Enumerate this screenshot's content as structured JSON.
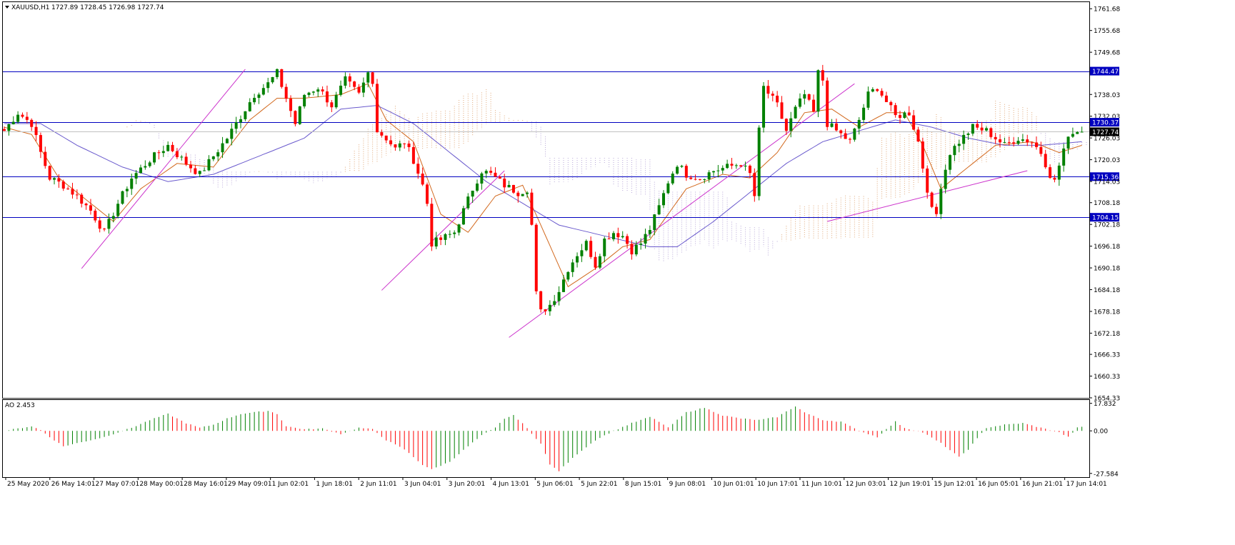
{
  "header": {
    "symbol": "XAUUSD,H1",
    "ohlc": "1727.89 1728.45 1726.98 1727.74"
  },
  "ao_header": {
    "label": "AO 2.453"
  },
  "colors": {
    "bull": "#008000",
    "bear": "#ff0000",
    "hline": "#0000c0",
    "trendline": "#cc33cc",
    "ma_fast": "#d2691e",
    "ma_slow": "#6a5acd",
    "cloud_bull": "#e0a878",
    "cloud_bear": "#b8a8d8",
    "current_line": "#c0c0c0"
  },
  "chart_data": [
    {
      "type": "candlestick",
      "title": "XAUUSD,H1",
      "y_axis_ticks": [
        "1761.68",
        "1755.68",
        "1749.68",
        "1744.47",
        "1738.03",
        "1732.03",
        "1730.37",
        "1727.74",
        "1726.03",
        "1720.03",
        "1715.36",
        "1714.03",
        "1708.18",
        "1704.15",
        "1702.18",
        "1696.18",
        "1690.18",
        "1684.18",
        "1678.18",
        "1672.18",
        "1666.33",
        "1660.33",
        "1654.33"
      ],
      "x_axis_ticks": [
        "25 May 2020",
        "26 May 14:01",
        "27 May 07:01",
        "28 May 00:01",
        "28 May 16:01",
        "29 May 09:01",
        "1 Jun 02:01",
        "1 Jun 18:01",
        "2 Jun 11:01",
        "3 Jun 04:01",
        "3 Jun 20:01",
        "4 Jun 13:01",
        "5 Jun 06:01",
        "5 Jun 22:01",
        "8 Jun 15:01",
        "9 Jun 08:01",
        "10 Jun 01:01",
        "10 Jun 17:01",
        "11 Jun 10:01",
        "12 Jun 03:01",
        "12 Jun 19:01",
        "15 Jun 12:01",
        "16 Jun 05:01",
        "16 Jun 21:01",
        "17 Jun 14:01"
      ],
      "ylim": [
        1654.33,
        1763.5
      ],
      "horizontal_levels": [
        {
          "label": "1744.47",
          "value": 1744.47
        },
        {
          "label": "1730.37",
          "value": 1730.37
        },
        {
          "label": "1715.36",
          "value": 1715.36
        },
        {
          "label": "1704.15",
          "value": 1704.15
        }
      ],
      "current_price": {
        "label": "1727.74",
        "value": 1727.74
      },
      "close_path": [
        [
          0,
          1728
        ],
        [
          3,
          1733
        ],
        [
          6,
          1730
        ],
        [
          8,
          1722
        ],
        [
          10,
          1715
        ],
        [
          13,
          1713
        ],
        [
          16,
          1710
        ],
        [
          19,
          1706
        ],
        [
          22,
          1700
        ],
        [
          25,
          1708
        ],
        [
          28,
          1715
        ],
        [
          32,
          1720
        ],
        [
          36,
          1724
        ],
        [
          40,
          1719
        ],
        [
          43,
          1716
        ],
        [
          46,
          1721
        ],
        [
          49,
          1726
        ],
        [
          52,
          1732
        ],
        [
          55,
          1738
        ],
        [
          58,
          1741
        ],
        [
          60,
          1744
        ],
        [
          62,
          1737
        ],
        [
          64,
          1730
        ],
        [
          66,
          1738
        ],
        [
          69,
          1740
        ],
        [
          72,
          1735
        ],
        [
          75,
          1742
        ],
        [
          78,
          1738
        ],
        [
          80,
          1744
        ],
        [
          81,
          1742
        ],
        [
          82,
          1728
        ],
        [
          84,
          1726
        ],
        [
          86,
          1723
        ],
        [
          88,
          1725
        ],
        [
          90,
          1720
        ],
        [
          92,
          1713
        ],
        [
          93,
          1708
        ],
        [
          94,
          1697
        ],
        [
          96,
          1698
        ],
        [
          99,
          1700
        ],
        [
          101,
          1706
        ],
        [
          103,
          1712
        ],
        [
          105,
          1717
        ],
        [
          107,
          1716
        ],
        [
          110,
          1713
        ],
        [
          113,
          1711
        ],
        [
          115,
          1712
        ],
        [
          116,
          1702
        ],
        [
          117,
          1683
        ],
        [
          118,
          1678
        ],
        [
          120,
          1680
        ],
        [
          122,
          1684
        ],
        [
          124,
          1690
        ],
        [
          126,
          1694
        ],
        [
          128,
          1697
        ],
        [
          130,
          1691
        ],
        [
          132,
          1698
        ],
        [
          134,
          1700
        ],
        [
          136,
          1699
        ],
        [
          138,
          1695
        ],
        [
          140,
          1697
        ],
        [
          142,
          1701
        ],
        [
          144,
          1707
        ],
        [
          146,
          1714
        ],
        [
          148,
          1719
        ],
        [
          150,
          1716
        ],
        [
          153,
          1715
        ],
        [
          156,
          1717
        ],
        [
          159,
          1718
        ],
        [
          162,
          1719
        ],
        [
          164,
          1716
        ],
        [
          165,
          1710
        ],
        [
          166,
          1728
        ],
        [
          167,
          1740
        ],
        [
          170,
          1735
        ],
        [
          172,
          1728
        ],
        [
          174,
          1734
        ],
        [
          176,
          1738
        ],
        [
          178,
          1733
        ],
        [
          179,
          1744
        ],
        [
          180,
          1742
        ],
        [
          181,
          1730
        ],
        [
          183,
          1728
        ],
        [
          186,
          1725
        ],
        [
          188,
          1731
        ],
        [
          190,
          1738
        ],
        [
          192,
          1740
        ],
        [
          194,
          1736
        ],
        [
          196,
          1732
        ],
        [
          199,
          1733
        ],
        [
          201,
          1725
        ],
        [
          202,
          1718
        ],
        [
          203,
          1712
        ],
        [
          204,
          1706
        ],
        [
          205,
          1705
        ],
        [
          206,
          1713
        ],
        [
          208,
          1722
        ],
        [
          210,
          1725
        ],
        [
          213,
          1729
        ],
        [
          216,
          1728
        ],
        [
          218,
          1726
        ],
        [
          220,
          1724
        ],
        [
          223,
          1726
        ],
        [
          226,
          1725
        ],
        [
          228,
          1722
        ],
        [
          230,
          1716
        ],
        [
          231,
          1714
        ],
        [
          233,
          1723
        ],
        [
          235,
          1728
        ],
        [
          237,
          1727.74
        ]
      ],
      "moving_averages": [
        {
          "name": "",
          "color": "#d2691e",
          "values": [
            [
              0,
              1729
            ],
            [
              6,
              1727
            ],
            [
              12,
              1715
            ],
            [
              18,
              1709
            ],
            [
              24,
              1703
            ],
            [
              30,
              1712
            ],
            [
              38,
              1719
            ],
            [
              46,
              1718
            ],
            [
              54,
              1731
            ],
            [
              60,
              1737
            ],
            [
              66,
              1737
            ],
            [
              74,
              1738
            ],
            [
              80,
              1741
            ],
            [
              84,
              1731
            ],
            [
              90,
              1725
            ],
            [
              96,
              1705
            ],
            [
              102,
              1700
            ],
            [
              108,
              1710
            ],
            [
              114,
              1713
            ],
            [
              118,
              1702
            ],
            [
              124,
              1685
            ],
            [
              130,
              1690
            ],
            [
              136,
              1696
            ],
            [
              142,
              1698
            ],
            [
              150,
              1712
            ],
            [
              158,
              1716
            ],
            [
              164,
              1715
            ],
            [
              170,
              1722
            ],
            [
              176,
              1733
            ],
            [
              182,
              1734
            ],
            [
              188,
              1729
            ],
            [
              194,
              1733
            ],
            [
              198,
              1733
            ],
            [
              202,
              1724
            ],
            [
              206,
              1712
            ],
            [
              212,
              1718
            ],
            [
              218,
              1724
            ],
            [
              226,
              1725
            ],
            [
              232,
              1722
            ],
            [
              237,
              1724
            ]
          ]
        },
        {
          "name": "",
          "color": "#6a5acd",
          "values": [
            [
              0,
              1730
            ],
            [
              8,
              1730
            ],
            [
              16,
              1724
            ],
            [
              26,
              1718
            ],
            [
              36,
              1714
            ],
            [
              46,
              1716
            ],
            [
              56,
              1721
            ],
            [
              66,
              1726
            ],
            [
              74,
              1734
            ],
            [
              82,
              1735
            ],
            [
              90,
              1730
            ],
            [
              98,
              1722
            ],
            [
              106,
              1714
            ],
            [
              114,
              1708
            ],
            [
              122,
              1702
            ],
            [
              132,
              1699
            ],
            [
              142,
              1696
            ],
            [
              148,
              1696
            ],
            [
              156,
              1703
            ],
            [
              164,
              1711
            ],
            [
              172,
              1719
            ],
            [
              180,
              1725
            ],
            [
              188,
              1728
            ],
            [
              196,
              1731
            ],
            [
              204,
              1729
            ],
            [
              212,
              1726
            ],
            [
              220,
              1724
            ],
            [
              228,
              1724
            ],
            [
              237,
              1725
            ]
          ]
        }
      ],
      "trendlines": [
        {
          "from": [
            17,
            1690
          ],
          "to": [
            53,
            1745
          ]
        },
        {
          "from": [
            83,
            1684
          ],
          "to": [
            110,
            1717
          ]
        },
        {
          "from": [
            111,
            1671
          ],
          "to": [
            187,
            1741
          ]
        },
        {
          "from": [
            181,
            1703
          ],
          "to": [
            225,
            1717
          ]
        }
      ]
    },
    {
      "type": "bar",
      "title": "AO 2.453",
      "y_axis_ticks": [
        "17.832",
        "0.00",
        "-27.584"
      ],
      "ylim": [
        -30,
        20
      ],
      "histogram_path": [
        [
          0,
          0
        ],
        [
          3,
          1.5
        ],
        [
          6,
          3
        ],
        [
          8,
          0.5
        ],
        [
          10,
          -4
        ],
        [
          13,
          -10
        ],
        [
          16,
          -8
        ],
        [
          19,
          -6
        ],
        [
          22,
          -4
        ],
        [
          25,
          -1
        ],
        [
          28,
          2
        ],
        [
          32,
          7
        ],
        [
          36,
          11
        ],
        [
          40,
          5
        ],
        [
          43,
          2
        ],
        [
          46,
          4
        ],
        [
          49,
          8
        ],
        [
          52,
          11
        ],
        [
          55,
          12
        ],
        [
          58,
          13
        ],
        [
          60,
          11
        ],
        [
          62,
          3
        ],
        [
          66,
          1
        ],
        [
          70,
          1.5
        ],
        [
          74,
          -2
        ],
        [
          78,
          2
        ],
        [
          81,
          1
        ],
        [
          84,
          -6
        ],
        [
          88,
          -12
        ],
        [
          92,
          -22
        ],
        [
          94,
          -25
        ],
        [
          98,
          -20
        ],
        [
          102,
          -10
        ],
        [
          105,
          -3
        ],
        [
          108,
          2
        ],
        [
          110,
          8
        ],
        [
          112,
          10
        ],
        [
          114,
          5
        ],
        [
          116,
          -2
        ],
        [
          118,
          -8
        ],
        [
          120,
          -22
        ],
        [
          122,
          -26
        ],
        [
          126,
          -15
        ],
        [
          130,
          -6
        ],
        [
          134,
          0
        ],
        [
          138,
          5
        ],
        [
          142,
          9
        ],
        [
          144,
          6
        ],
        [
          146,
          2
        ],
        [
          150,
          12
        ],
        [
          154,
          15
        ],
        [
          158,
          10
        ],
        [
          162,
          8
        ],
        [
          166,
          7
        ],
        [
          170,
          9
        ],
        [
          174,
          16
        ],
        [
          176,
          12
        ],
        [
          180,
          7
        ],
        [
          184,
          6
        ],
        [
          188,
          0
        ],
        [
          192,
          -4
        ],
        [
          196,
          6
        ],
        [
          198,
          2
        ],
        [
          202,
          -1
        ],
        [
          206,
          -8
        ],
        [
          210,
          -17
        ],
        [
          212,
          -12
        ],
        [
          216,
          2
        ],
        [
          220,
          4
        ],
        [
          224,
          5
        ],
        [
          228,
          2
        ],
        [
          232,
          -1
        ],
        [
          234,
          -4
        ],
        [
          236,
          2
        ],
        [
          237,
          2.5
        ]
      ]
    }
  ]
}
